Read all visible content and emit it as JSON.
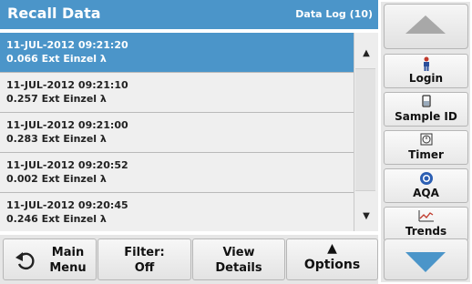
{
  "header": {
    "title": "Recall Data",
    "log": "Data Log (10)"
  },
  "rows": [
    {
      "l1": "11-JUL-2012  09:21:20",
      "l2": "0.066  Ext  Einzel λ"
    },
    {
      "l1": "11-JUL-2012  09:21:10",
      "l2": "0.257  Ext  Einzel λ"
    },
    {
      "l1": "11-JUL-2012  09:21:00",
      "l2": "0.283  Ext  Einzel λ"
    },
    {
      "l1": "11-JUL-2012  09:20:52",
      "l2": "0.002  Ext  Einzel λ"
    },
    {
      "l1": "11-JUL-2012  09:20:45",
      "l2": "0.246  Ext  Einzel λ"
    }
  ],
  "scroll": {
    "up": "▲",
    "down": "▼"
  },
  "sidebar": {
    "login": "Login",
    "sample_id": "Sample ID",
    "timer": "Timer",
    "aqa": "AQA",
    "trends": "Trends"
  },
  "bottom": {
    "main_menu_1": "Main",
    "main_menu_2": "Menu",
    "filter_1": "Filter:",
    "filter_2": "Off",
    "view_1": "View",
    "view_2": "Details",
    "options_arrow": "▲",
    "options": "Options"
  },
  "colors": {
    "accent": "#4b95c9"
  }
}
